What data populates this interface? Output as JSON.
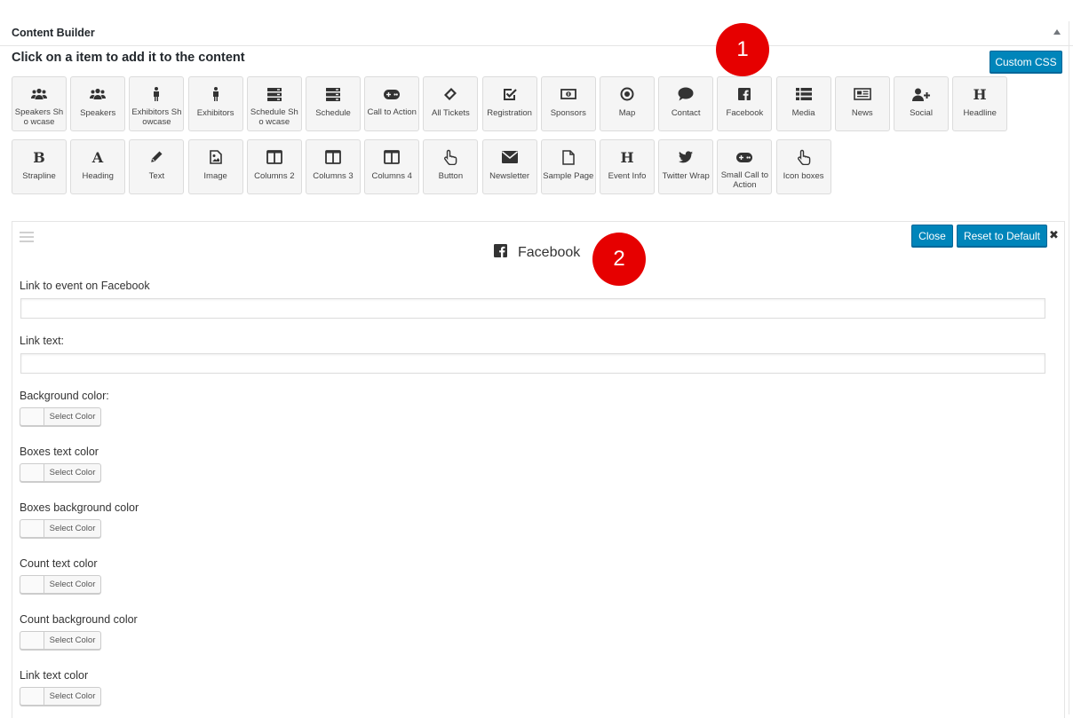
{
  "panel": {
    "title": "Content Builder"
  },
  "instruction": "Click on a item to add it to the content",
  "custom_css_label": "Custom CSS",
  "tiles_row1": [
    {
      "label": "Speakers Sho wcase",
      "icon": "users-icon"
    },
    {
      "label": "Speakers",
      "icon": "users-icon"
    },
    {
      "label": "Exhibitors Sh owcase",
      "icon": "person-icon"
    },
    {
      "label": "Exhibitors",
      "icon": "person-icon"
    },
    {
      "label": "Schedule Sho wcase",
      "icon": "server-icon"
    },
    {
      "label": "Schedule",
      "icon": "server-icon"
    },
    {
      "label": "Call to Action",
      "icon": "gamepad-icon"
    },
    {
      "label": "All Tickets",
      "icon": "ticket-icon"
    },
    {
      "label": "Registration",
      "icon": "checkbox-icon"
    },
    {
      "label": "Sponsors",
      "icon": "money-icon"
    },
    {
      "label": "Map",
      "icon": "dot-circle-icon"
    },
    {
      "label": "Contact",
      "icon": "comment-icon"
    },
    {
      "label": "Facebook",
      "icon": "facebook-icon"
    },
    {
      "label": "Media",
      "icon": "list-icon"
    },
    {
      "label": "News",
      "icon": "newspaper-icon"
    },
    {
      "label": "Social",
      "icon": "user-plus-icon"
    },
    {
      "label": "Headline",
      "icon": "header-icon"
    }
  ],
  "tiles_row2": [
    {
      "label": "Strapline",
      "icon": "bold-icon"
    },
    {
      "label": "Heading",
      "icon": "font-icon"
    },
    {
      "label": "Text",
      "icon": "pencil-icon"
    },
    {
      "label": "Image",
      "icon": "image-icon"
    },
    {
      "label": "Columns 2",
      "icon": "columns-icon"
    },
    {
      "label": "Columns 3",
      "icon": "columns-icon"
    },
    {
      "label": "Columns 4",
      "icon": "columns-icon"
    },
    {
      "label": "Button",
      "icon": "pointer-icon"
    },
    {
      "label": "Newsletter",
      "icon": "envelope-icon"
    },
    {
      "label": "Sample Page",
      "icon": "file-icon"
    },
    {
      "label": "Event Info",
      "icon": "header-icon"
    },
    {
      "label": "Twitter Wrap",
      "icon": "twitter-icon"
    },
    {
      "label": "Small Call to Action",
      "icon": "gamepad-icon"
    },
    {
      "label": "Icon boxes",
      "icon": "pointer-icon"
    }
  ],
  "badges": [
    "1",
    "2"
  ],
  "editor": {
    "title": "Facebook",
    "close_label": "Close",
    "reset_label": "Reset to Default",
    "close_icon": "✖",
    "link_label": "Link to event on Facebook",
    "link_value": "",
    "link_text_label": "Link text:",
    "link_text_value": "",
    "color_fields": [
      {
        "label": "Background color:",
        "button": "Select Color"
      },
      {
        "label": "Boxes text color",
        "button": "Select Color"
      },
      {
        "label": "Boxes background color",
        "button": "Select Color"
      },
      {
        "label": "Count text color",
        "button": "Select Color"
      },
      {
        "label": "Count background color",
        "button": "Select Color"
      },
      {
        "label": "Link text color",
        "button": "Select Color"
      }
    ]
  },
  "colors": {
    "accent": "#0085ba",
    "badge": "#e60000"
  }
}
